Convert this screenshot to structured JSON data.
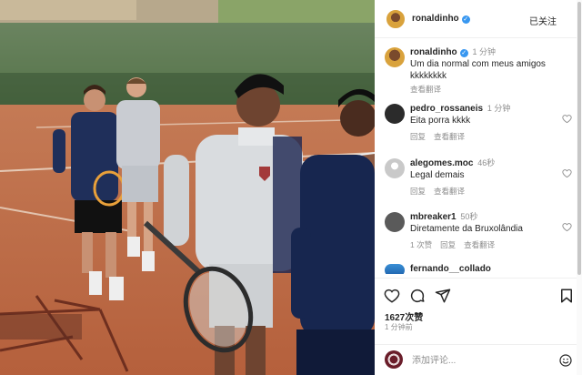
{
  "post": {
    "author": "ronaldinho",
    "follow_label": "已关注",
    "caption_time": "1 分钟",
    "caption_text": "Um dia normal com meus amigos kkkkkkkk",
    "caption_translate": "查看翻译",
    "likes": "1627次赞",
    "posted_ago": "1 分钟前"
  },
  "comments": [
    {
      "user": "pedro_rossaneis",
      "time": "1 分钟",
      "text": "Eita porra kkkk",
      "reply": "回复",
      "translate": "查看翻译",
      "avatar_color": "#2b2b2b"
    },
    {
      "user": "alegomes.moc",
      "time": "46秒",
      "text": "Legal demais",
      "reply": "回复",
      "translate": "查看翻译",
      "avatar_color": "#c9c9c9"
    },
    {
      "user": "mbreaker1",
      "time": "50秒",
      "text": "Diretamente da Bruxolândia",
      "likes": "1 次赞",
      "reply": "回复",
      "translate": "查看翻译",
      "avatar_color": "#5a5a5a"
    },
    {
      "user": "fernando__collado",
      "avatar_color": "#3a8fd6"
    }
  ],
  "add_comment": {
    "placeholder": "添加评论..."
  },
  "icons": {
    "like": "heart-icon",
    "comment": "comment-icon",
    "share": "paper-plane-icon",
    "save": "bookmark-icon",
    "verified": "verified-badge-icon",
    "emoji": "emoji-icon"
  },
  "colors": {
    "verified_blue": "#3897f0",
    "muted_text": "#8e8e8e",
    "text": "#262626"
  }
}
